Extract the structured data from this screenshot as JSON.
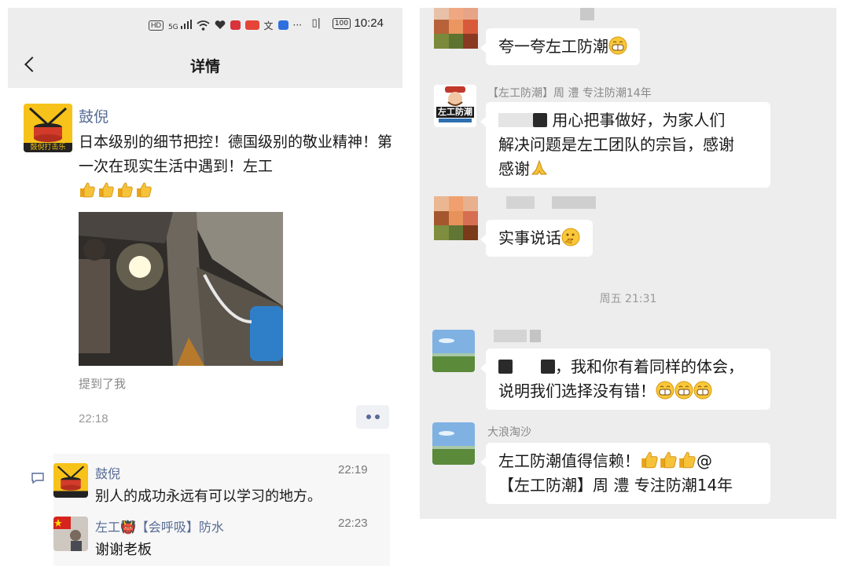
{
  "status_bar": {
    "net_badge_hd": "HD",
    "net_badge_5g": "5G",
    "more": "···",
    "battery": "100",
    "time": "10:24"
  },
  "nav": {
    "title": "详情"
  },
  "post": {
    "author": "鼓倪",
    "avatar_label": "鼓倪打击乐",
    "text": "日本级别的细节把控！德国级别的敬业精神！第一次在现实生活中遇到！左工",
    "thumbs_count": 4,
    "mention": "提到了我",
    "time": "22:18"
  },
  "comments": [
    {
      "name": "鼓倪",
      "time": "22:19",
      "text": "别人的成功永远有可以学习的地方。"
    },
    {
      "name": "左工👹【会呼吸】防水",
      "time": "22:23",
      "text": "谢谢老板"
    }
  ],
  "chat": {
    "msg1": {
      "text": "夸一夸左工防潮"
    },
    "msg2": {
      "sender": "【左工防潮】周 澧  专注防潮14年",
      "avatar_label": "左工防潮",
      "line1": "用心把事做好，为家人们",
      "line2": "解决问题是左工团队的宗旨，感谢",
      "line3": "感谢"
    },
    "msg3": {
      "text": "实事说话"
    },
    "divider": "周五 21:31",
    "msg4": {
      "line1": "，我和你有着同样的体会，",
      "line2": "说明我们选择没有错！"
    },
    "msg5": {
      "sender": "大浪淘沙",
      "line1": "左工防潮值得信赖！",
      "line1_tail": "@",
      "line2": "【左工防潮】周 澧  专注防潮14年"
    }
  },
  "colors": {
    "link_blue": "#576b95",
    "chat_bg": "#ededed",
    "bubble": "#ffffff",
    "drum_yellow": "#f7c21a"
  }
}
